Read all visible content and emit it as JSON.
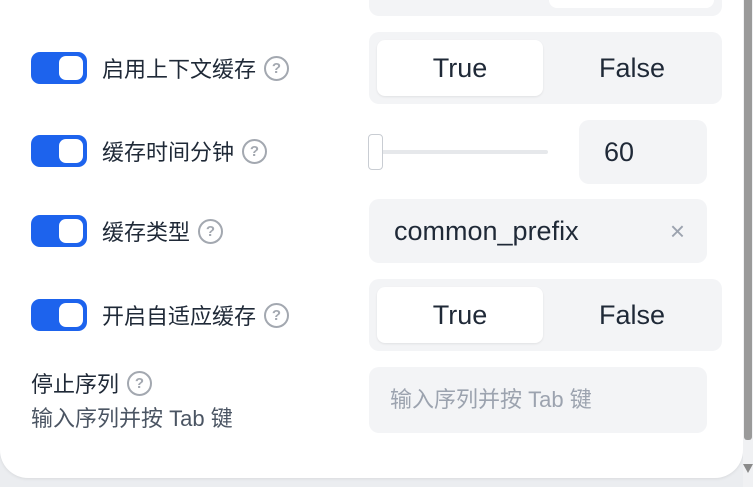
{
  "settings": {
    "context_cache": {
      "enabled": true,
      "label": "启用上下文缓存",
      "help_icon": "?",
      "options": [
        "True",
        "False"
      ],
      "selected": "True"
    },
    "cache_minutes": {
      "enabled": true,
      "label": "缓存时间分钟",
      "help_icon": "?",
      "slider_fraction": 0.0,
      "value": "60"
    },
    "cache_type": {
      "enabled": true,
      "label": "缓存类型",
      "help_icon": "?",
      "value": "common_prefix",
      "clear_icon": "×"
    },
    "adaptive_cache": {
      "enabled": true,
      "label": "开启自适应缓存",
      "help_icon": "?",
      "options": [
        "True",
        "False"
      ],
      "selected": "True"
    },
    "stop_sequences": {
      "label": "停止序列",
      "help_icon": "?",
      "description": "输入序列并按 Tab 键",
      "placeholder": "输入序列并按 Tab 键"
    }
  },
  "colors": {
    "accent": "#1d63ed",
    "panel_bg": "#ffffff",
    "control_bg": "#f3f4f6"
  }
}
